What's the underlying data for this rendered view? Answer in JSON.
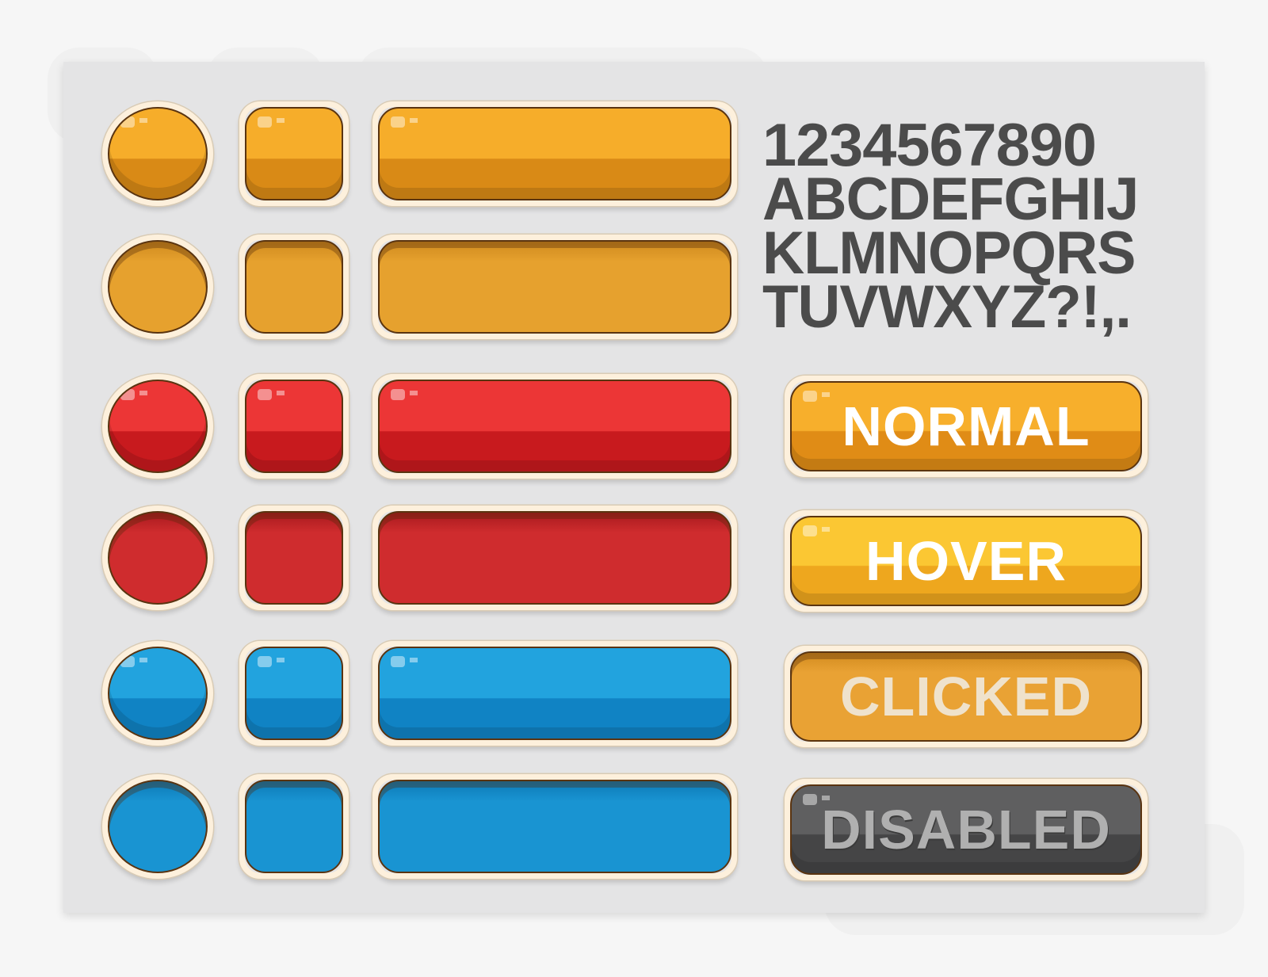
{
  "glyph_lines": [
    "1234567890",
    "ABCDEFGHIJ",
    "KLMNOPQRS",
    "TUVWXYZ?!,."
  ],
  "rows": [
    {
      "variant": "orange-normal",
      "base": "#f6ad2a",
      "dark": "#d98a16",
      "pressed": false
    },
    {
      "variant": "orange-pressed",
      "base": "#e6a12e",
      "dark": "#cf8a1e",
      "pressed": true
    },
    {
      "variant": "red-normal",
      "base": "#ec3636",
      "dark": "#c81a1e",
      "pressed": false
    },
    {
      "variant": "red-pressed",
      "base": "#cf2c2e",
      "dark": "#a81a1e",
      "pressed": true
    },
    {
      "variant": "blue-normal",
      "base": "#22a3de",
      "dark": "#1083c4",
      "pressed": false
    },
    {
      "variant": "blue-pressed",
      "base": "#1994d2",
      "dark": "#0d7ab6",
      "pressed": true
    }
  ],
  "state_buttons": [
    {
      "label": "NORMAL",
      "base": "#f7af2c",
      "dark": "#e08c16",
      "text": "#ffffff",
      "pressed": false
    },
    {
      "label": "HOVER",
      "base": "#fbc733",
      "dark": "#eea71e",
      "text": "#ffffff",
      "pressed": false
    },
    {
      "label": "CLICKED",
      "base": "#e9a234",
      "dark": "#d18a1e",
      "text": "#efe2cc",
      "pressed": true
    },
    {
      "label": "DISABLED",
      "base": "#5f5f60",
      "dark": "#454546",
      "text": "#b0b0b0",
      "pressed": false
    }
  ]
}
